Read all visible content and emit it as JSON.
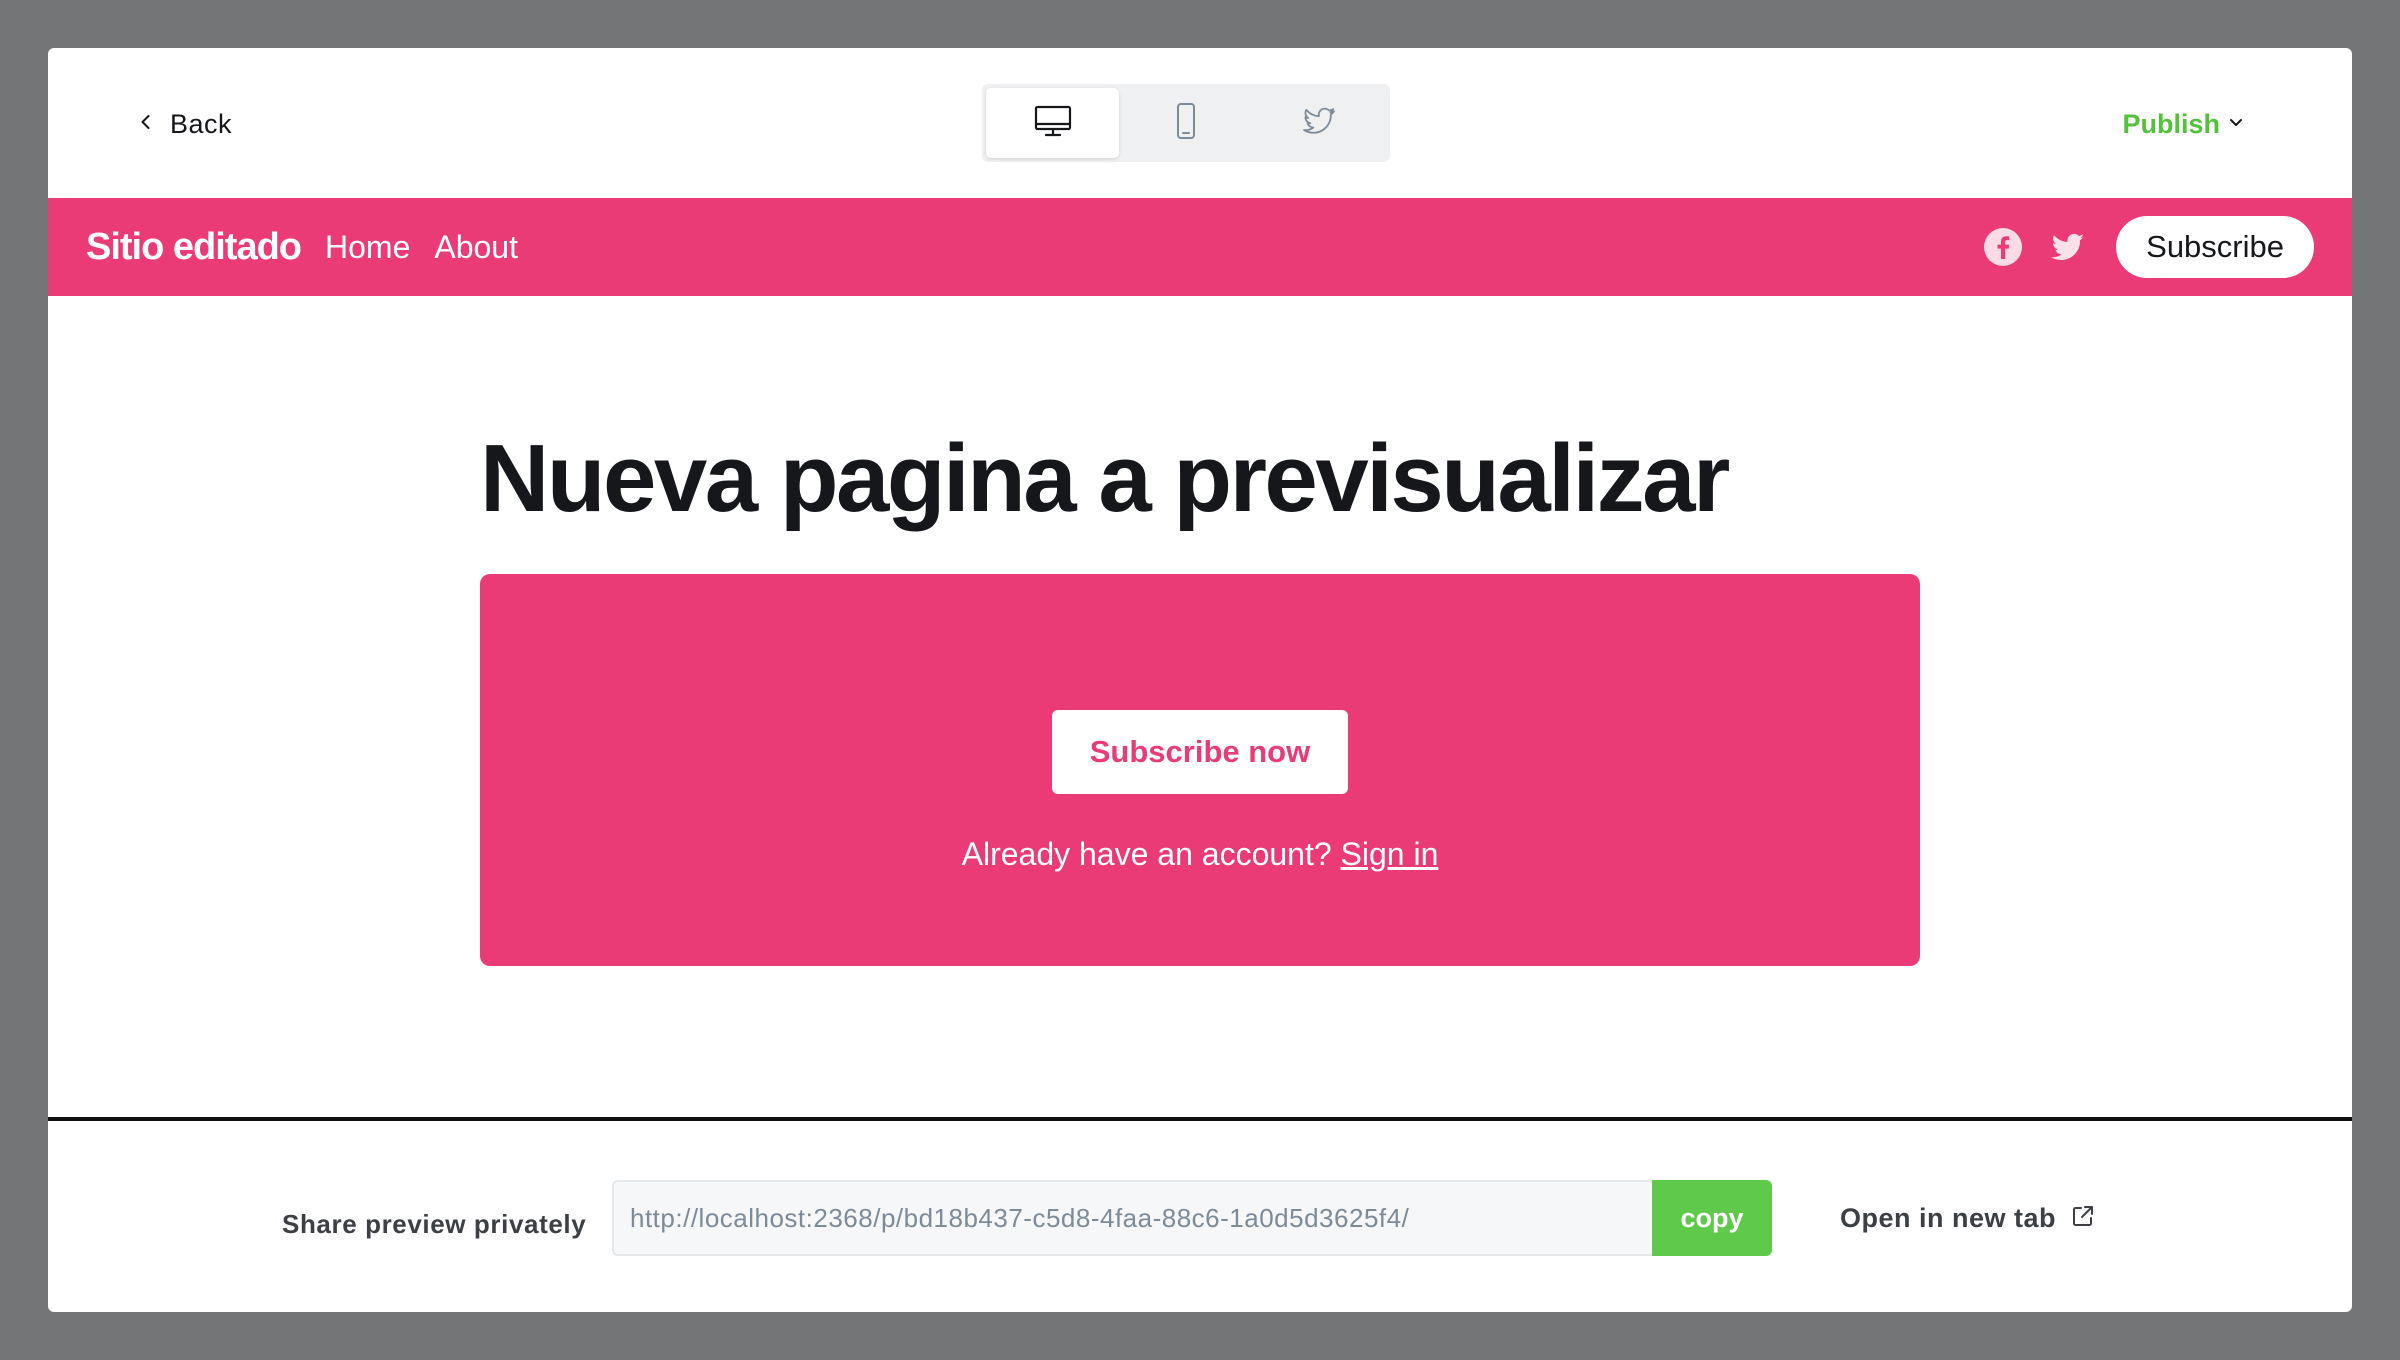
{
  "colors": {
    "accent": "#eb3b77",
    "publish": "#53c13c",
    "copy_button": "#5fc94b",
    "text_dark": "#15171a",
    "icon_gray": "#7c8b9a"
  },
  "toolbar": {
    "back_label": "Back",
    "back_icon": "chevron-left-icon",
    "devices": [
      {
        "name": "desktop",
        "icon": "monitor-icon",
        "active": true
      },
      {
        "name": "mobile",
        "icon": "smartphone-icon",
        "active": false
      },
      {
        "name": "twitter",
        "icon": "twitter-icon",
        "active": false
      }
    ],
    "publish_label": "Publish",
    "publish_icon": "chevron-down-icon"
  },
  "site": {
    "title": "Sitio editado",
    "nav_links": [
      "Home",
      "About"
    ],
    "social_icons": [
      "facebook-icon",
      "twitter-icon"
    ],
    "subscribe_label": "Subscribe"
  },
  "content": {
    "page_title": "Nueva pagina a previsualizar",
    "cta_button_label": "Subscribe now",
    "signin_prompt": "Already have an account?",
    "signin_link": "Sign in"
  },
  "share": {
    "label": "Share preview privately",
    "url": "http://localhost:2368/p/bd18b437-c5d8-4faa-88c6-1a0d5d3625f4/",
    "copy_label": "copy",
    "open_tab_label": "Open in new tab",
    "open_tab_icon": "external-link-icon"
  }
}
